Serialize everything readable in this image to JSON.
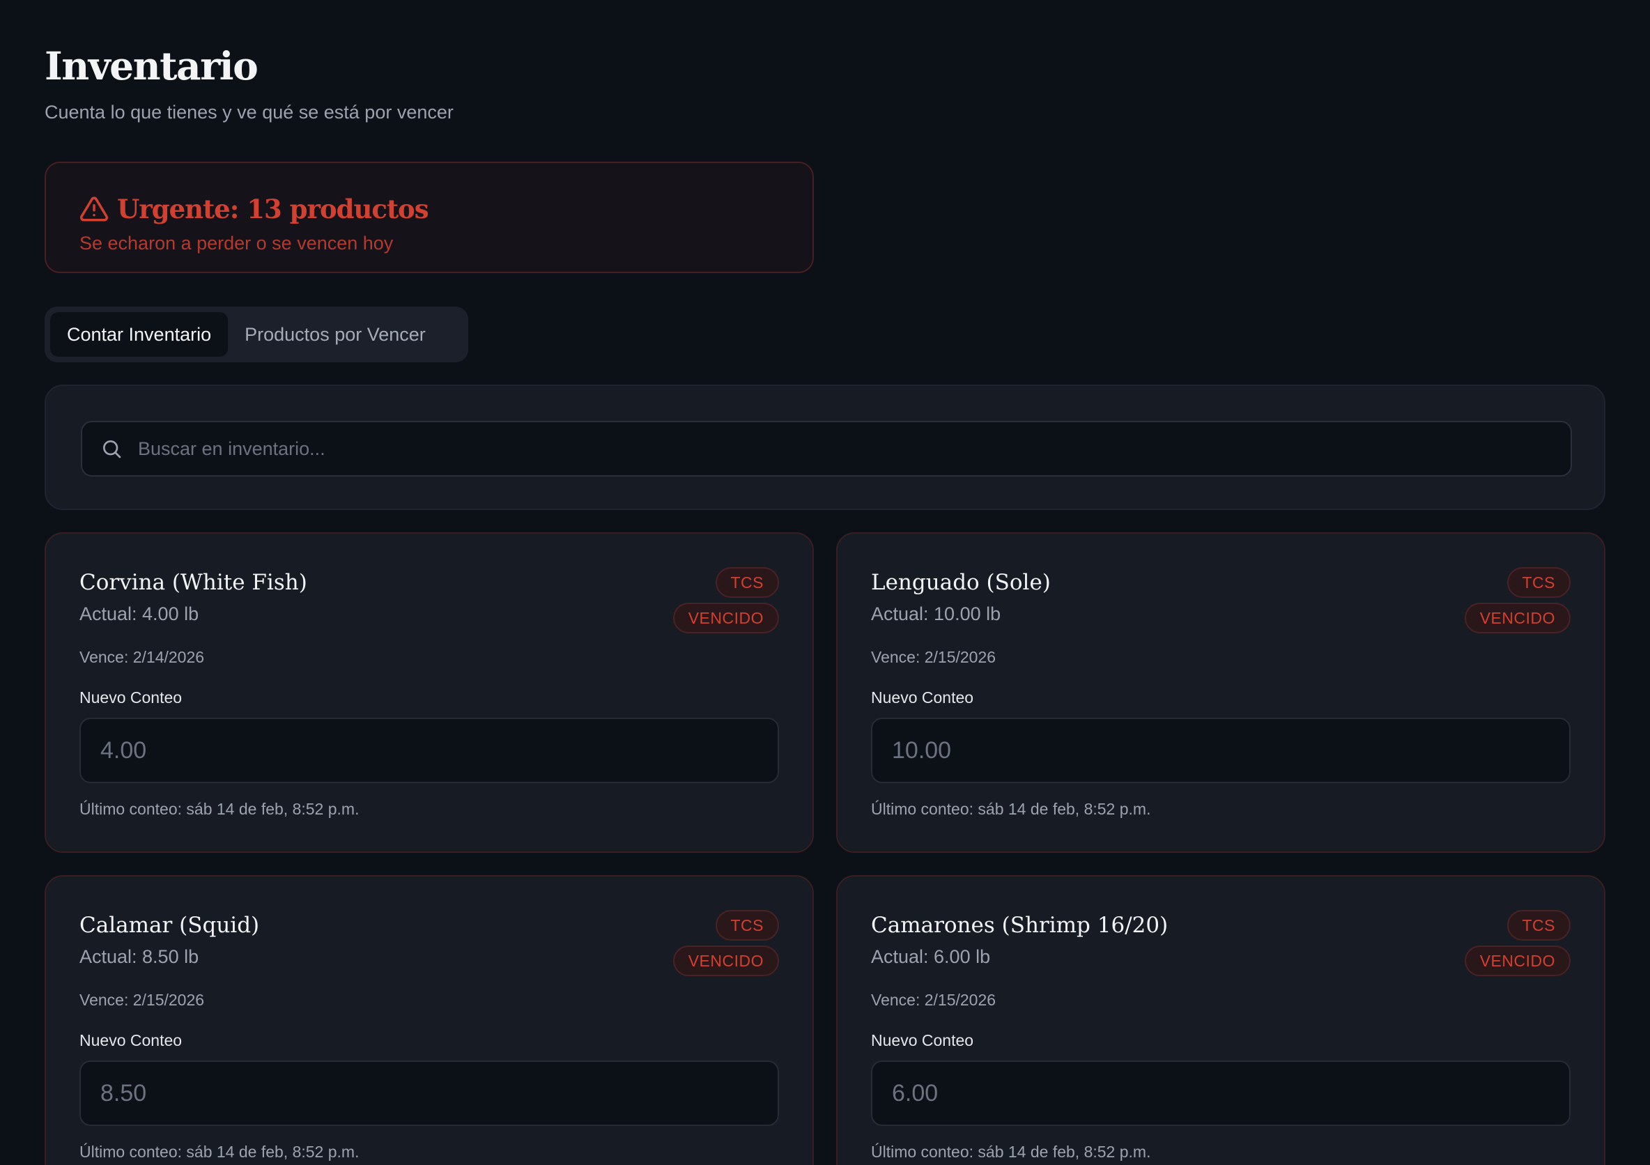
{
  "header": {
    "title": "Inventario",
    "subtitle": "Cuenta lo que tienes y ve qué se está por vencer"
  },
  "alert": {
    "icon": "warning-triangle-icon",
    "title": "Urgente: 13 productos",
    "message": "Se echaron a perder o se vencen hoy",
    "color": "#d3402f"
  },
  "tabs": [
    {
      "label": "Contar Inventario",
      "active": true
    },
    {
      "label": "Productos por Vencer",
      "active": false
    }
  ],
  "search": {
    "icon": "search-icon",
    "placeholder": "Buscar en inventario..."
  },
  "count_label": "Nuevo Conteo",
  "items": [
    {
      "name": "Corvina (White Fish)",
      "actual": "Actual: 4.00 lb",
      "tag": "TCS",
      "status": "VENCIDO",
      "expiry": "Vence: 2/14/2026",
      "placeholder": "4.00",
      "last_count": "Último conteo: sáb 14 de feb, 8:52 p.m."
    },
    {
      "name": "Lenguado (Sole)",
      "actual": "Actual: 10.00 lb",
      "tag": "TCS",
      "status": "VENCIDO",
      "expiry": "Vence: 2/15/2026",
      "placeholder": "10.00",
      "last_count": "Último conteo: sáb 14 de feb, 8:52 p.m."
    },
    {
      "name": "Calamar (Squid)",
      "actual": "Actual: 8.50 lb",
      "tag": "TCS",
      "status": "VENCIDO",
      "expiry": "Vence: 2/15/2026",
      "placeholder": "8.50",
      "last_count": "Último conteo: sáb 14 de feb, 8:52 p.m."
    },
    {
      "name": "Camarones (Shrimp 16/20)",
      "actual": "Actual: 6.00 lb",
      "tag": "TCS",
      "status": "VENCIDO",
      "expiry": "Vence: 2/15/2026",
      "placeholder": "6.00",
      "last_count": "Último conteo: sáb 14 de feb, 8:52 p.m."
    }
  ]
}
